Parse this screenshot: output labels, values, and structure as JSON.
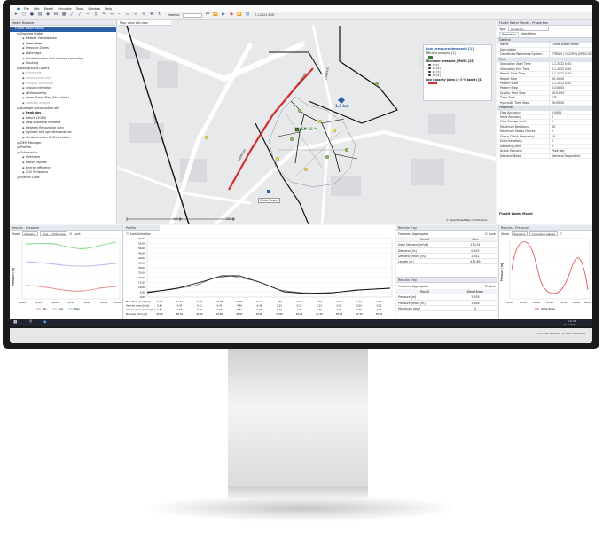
{
  "app": {
    "menu": [
      "File",
      "Edit",
      "Model",
      "Simulate",
      "Tools",
      "Window",
      "Help"
    ],
    "toolbar": {
      "material_label": "Material:",
      "date_value": "2.1.2022 0:00"
    }
  },
  "model_browser": {
    "title": "Model Browser",
    "items": [
      {
        "label": "Fluidit Water Model",
        "level": 0,
        "selected": true
      },
      {
        "label": "Drawing States",
        "level": 1
      },
      {
        "label": "Default Visualization",
        "level": 2
      },
      {
        "label": "Overview",
        "level": 2,
        "bold": true
      },
      {
        "label": "Pressure Zones",
        "level": 2
      },
      {
        "label": "Water age",
        "level": 2
      },
      {
        "label": "Contamination and chlorine spreading",
        "level": 2
      },
      {
        "label": "Flushing",
        "level": 2
      },
      {
        "label": "Background Layers",
        "level": 1
      },
      {
        "label": "Chemicals",
        "level": 2,
        "muted": true
      },
      {
        "label": "networkmap.dxf",
        "level": 2,
        "muted": true
      },
      {
        "label": "Contour pressures",
        "level": 2,
        "muted": true
      },
      {
        "label": "Ground elevation",
        "level": 2
      },
      {
        "label": "White overlay",
        "level": 2
      },
      {
        "label": "Open Street Map (No Labels)",
        "level": 2
      },
      {
        "label": "Satellite images",
        "level": 2,
        "muted": true
      },
      {
        "label": "Average consumption day",
        "level": 1,
        "italic": true
      },
      {
        "label": "Peak day",
        "level": 2,
        "bold": true
      },
      {
        "label": "Future (2040)",
        "level": 2
      },
      {
        "label": "New industrial demand",
        "level": 2
      },
      {
        "label": "Network Renovation plan",
        "level": 2
      },
      {
        "label": "Hydrant and sprinkler analysis",
        "level": 2
      },
      {
        "label": "Contamination & Chlorination",
        "level": 2
      },
      {
        "label": "DEM Manager",
        "level": 1
      },
      {
        "label": "Profiles",
        "level": 1
      },
      {
        "label": "Schematics",
        "level": 1
      },
      {
        "label": "Overview",
        "level": 2
      },
      {
        "label": "Report figures",
        "level": 2
      },
      {
        "label": "Energy efficiency",
        "level": 2
      },
      {
        "label": "CO2 Emissions",
        "level": 2
      },
      {
        "label": "Python Code",
        "level": 1
      }
    ]
  },
  "map": {
    "tab": "Map View Window",
    "legend": {
      "title": "Low pressure demands [1]",
      "efficient_label": "Efficient pumping [2]",
      "minimum_label": "Minimum pressure [MWS] [15]",
      "classes": [
        {
          "label": "0 [0]",
          "color": "#d32f2f"
        },
        {
          "label": "10 [0]",
          "color": "#ff9800"
        },
        {
          "label": "20 [3]",
          "color": "#ffeb3b"
        },
        {
          "label": "30 [9]",
          "color": "#8bc34a"
        }
      ],
      "low_capacity_label": "Low capacity pipes (> 0 % boost) [4]"
    },
    "annotations": {
      "pressure": "1.3 bar",
      "eff": "Eff 56 %",
      "tower": "WaterTower",
      "pipe1": "160PE100",
      "pipe2": "160PE100",
      "pipe3": "110PE100",
      "pipe4": "225 PE"
    },
    "scale_100": "100 m",
    "scale_200": "200 m",
    "attribution": "© OpenStreetMap contributors"
  },
  "properties": {
    "title": "Fluidit Water Model - Properties",
    "type_label": "Type:",
    "type_value": "Model (1)",
    "tabs": [
      "Properties",
      "Identifiers"
    ],
    "sections": [
      {
        "category": "General",
        "rows": [
          [
            "Name",
            "Fluidit Water Model"
          ],
          [
            "Description",
            ""
          ],
          [
            "Coordinate Reference System",
            "ETRS89 / GK25FIN (EPSG:3879)"
          ]
        ]
      },
      {
        "category": "Time",
        "rows": [
          [
            "Simulation Start Time",
            "1.1.2022 0:00"
          ],
          [
            "Simulation End Time",
            "3.1.2022 0:00"
          ],
          [
            "Report Start Time",
            "2.1.2022 0:00"
          ],
          [
            "Report Step",
            "00:10:00"
          ],
          [
            "Pattern Start",
            "1.1.2022 0:00"
          ],
          [
            "Pattern Step",
            "01:00:00"
          ],
          [
            "Quality Time Step",
            "00:01:00"
          ],
          [
            "Time Zone",
            "UTC"
          ],
          [
            "Hydraulic Time Step",
            "00:05:00"
          ]
        ]
      },
      {
        "category": "Properties",
        "rows": [
          [
            "Flow Accuracy",
            "0,0001"
          ],
          [
            "Head Accuracy",
            "0"
          ],
          [
            "Flow Change Limit",
            "0"
          ],
          [
            "Maximum Iterations",
            "50"
          ],
          [
            "Maximum Status Checks",
            "2"
          ],
          [
            "Status Check Frequency",
            "10"
          ],
          [
            "Extra Iterations",
            "0"
          ],
          [
            "Damping Limit",
            "0"
          ],
          [
            "Active Scenario",
            "Peak day"
          ],
          [
            "Demand Model",
            "Demand Dependent"
          ]
        ]
      }
    ],
    "footer": "Fluidit Water Model"
  },
  "results_left": {
    "title": "Results - Pressure",
    "show_label": "Show:",
    "select1": "Pressure",
    "select2": "Avg. + Extremes",
    "lock": "Lock",
    "ylabel": "Pressure [m]",
    "legend": [
      "Min",
      "Avg",
      "Max"
    ],
    "x_ticks": [
      "00:00",
      "04:00",
      "08:00",
      "12:00",
      "16:00",
      "20:00",
      "00:00"
    ]
  },
  "profile": {
    "title": "Profile",
    "lock": "Lock Selection",
    "y_ticks": [
      "60,00",
      "55,00",
      "50,00",
      "45,00",
      "40,00",
      "35,00",
      "30,00",
      "25,00",
      "20,00",
      "15,00",
      "10,00",
      "5,00",
      "0,00"
    ],
    "table_labels": [
      "Max. Flow (max) [l/s]",
      "Velocity (max) [m/s]",
      "Unit head loss (max) [‰]",
      "Pressure (min) [m]"
    ],
    "table_values": [
      [
        "14,06",
        "14,01",
        "14,01",
        "13,98",
        "13,96",
        "12,16",
        "7,86",
        "7,97",
        "4,33",
        "2,62",
        "1,74",
        "0,83"
      ],
      [
        "0,41",
        "0,41",
        "0,41",
        "0,41",
        "0,40",
        "0,36",
        "0,23",
        "0,23",
        "0,13",
        "0,08",
        "0,05",
        "0,02"
      ],
      [
        "0,85",
        "0,85",
        "0,85",
        "0,87",
        "0,87",
        "0,90",
        "0,40",
        "1,83",
        "1,65",
        "0,86",
        "0,35",
        "0,06"
      ],
      [
        "34,60",
        "56,32",
        "42,00",
        "33,00",
        "46,97",
        "32,80",
        "33,80",
        "44,90",
        "41,40",
        "38,50",
        "27,30",
        "30,35"
      ]
    ]
  },
  "results_tray_1": {
    "title": "Results Tray",
    "tabs": [
      "Features",
      "Aggregates"
    ],
    "lock": "Lock",
    "header": [
      "Result",
      "Sum"
    ],
    "rows": [
      [
        "Daily Demand [m³/d]",
        "110,54"
      ],
      [
        "Demand [l/s]",
        "0,425"
      ],
      [
        "Demand (max) [l/s]",
        "2,341"
      ],
      [
        "Length [m]",
        "451,69"
      ]
    ]
  },
  "results_tray_2": {
    "title": "Results Tray",
    "tabs": [
      "Features",
      "Aggregates"
    ],
    "lock": "Lock",
    "header": [
      "Result",
      "WaterTower"
    ],
    "rows": [
      [
        "Pressure [m]",
        "2,978"
      ],
      [
        "Pressure (max) [m]",
        "3,846"
      ],
      [
        "Maximum Level",
        "4"
      ]
    ]
  },
  "results_right": {
    "title": "Results - Pressure",
    "show_label": "Show:",
    "select1": "Pressure",
    "select2": "Individual Values",
    "lock": "Lock",
    "ylabel": "Pressure [m]",
    "legend": [
      "WaterTower"
    ],
    "x_ticks": [
      "00:00",
      "04:00",
      "08:00",
      "12:00",
      "16:00",
      "20:00",
      "00:00"
    ]
  },
  "status": {
    "coords": "x: 25 496 126,120 , y: 6 674 976,920",
    "time": "16.36",
    "date": "27.8.2021"
  },
  "colors": {
    "accent": "#2b5fa8",
    "low_capacity": "#e53935",
    "title_bar": "#e6e9ef"
  }
}
